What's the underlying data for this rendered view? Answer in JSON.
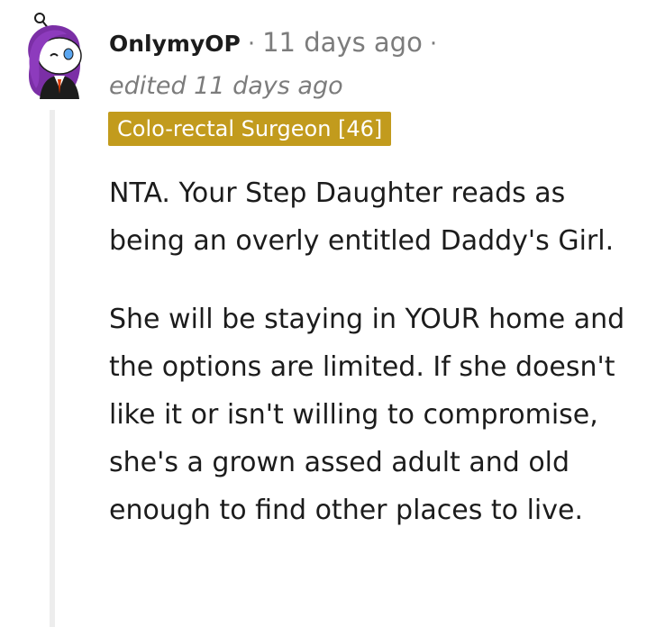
{
  "comment": {
    "username": "OnlymyOP",
    "separator": "·",
    "timestamp": "11 days ago",
    "edited": "edited 11 days ago",
    "flair": "Colo-rectal Surgeon [46]",
    "paragraphs": [
      "NTA. Your Step Daughter reads as being an overly entitled Daddy's Girl.",
      "She will be staying in YOUR home and the options are limited. If she doesn't like it or isn't willing to compromise, she's a grown assed adult and old enough to find other places to live."
    ]
  },
  "colors": {
    "flair_background": "#c29b1d",
    "avatar_hair": "#7b2fa6",
    "muted_text": "#7c7c7c",
    "thread_line": "#ededed"
  }
}
